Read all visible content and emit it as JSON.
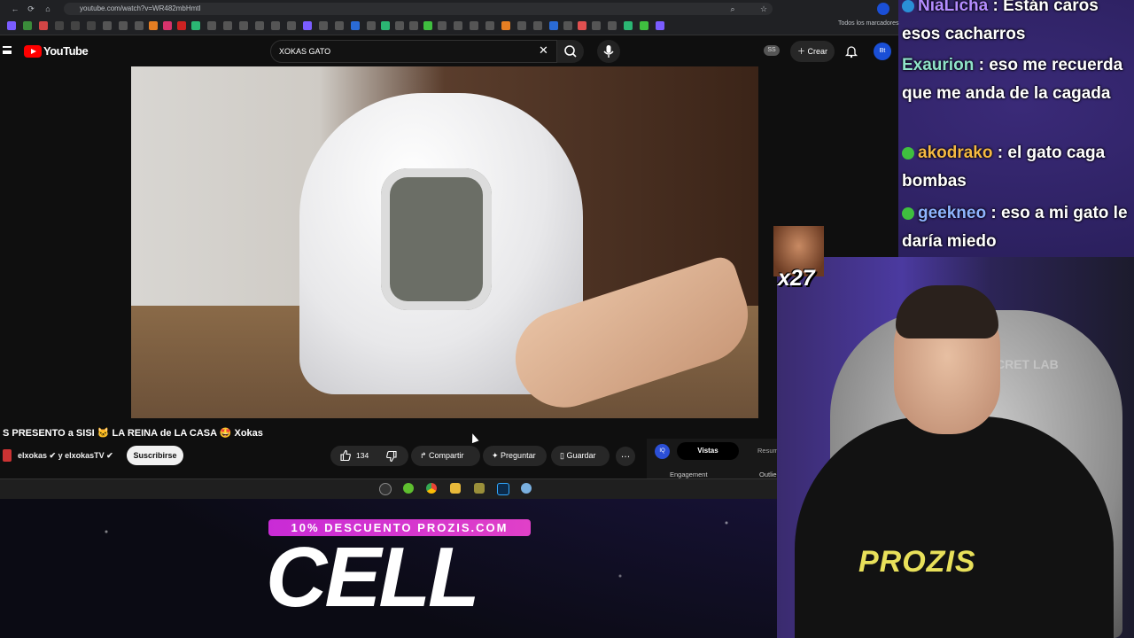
{
  "browser": {
    "url": "youtube.com/watch?v=WR482mbHmtI",
    "bookmarks_all": "Todos los marcadores"
  },
  "youtube": {
    "logo_text": "YouTube",
    "search_value": "XOKAS GATO",
    "ss_badge": "SS",
    "create_label": "Crear",
    "avatar_text": "Bt",
    "video": {
      "title": "S PRESENTO a SISI 🐱 LA REINA de LA CASA 🤩 Xokas",
      "channel": "elxokas ✔ y elxokasTV ✔",
      "subscribe_label": "Suscribirse",
      "likes": "134",
      "share_label": "Compartir",
      "ask_label": "Preguntar",
      "save_label": "Guardar",
      "more_label": "…"
    },
    "extension": {
      "icon_text": "IQ",
      "tab_views": "Vistas",
      "tab_summary": "Resum",
      "engagement_label": "Engagement",
      "outliers_label": "Outlie"
    }
  },
  "chat": [
    {
      "user": "NiaLicha",
      "user_color": "#b48cff",
      "message": ": Están caros esos cacharros"
    },
    {
      "user": "Exaurion",
      "user_color": "#8fe3c9",
      "message": ": eso me recuerda que me anda de la cagada"
    },
    {
      "user": "akodrako",
      "user_color": "#f5b942",
      "message": ": el gato caga bombas"
    },
    {
      "user": "geekneo",
      "user_color": "#8fb5ff",
      "message": ": eso a mi gato le daría miedo"
    }
  ],
  "emote": {
    "count": "x27"
  },
  "webcam": {
    "shirt_text": "PROZIS",
    "sign_text": "CRET LAB"
  },
  "ad": {
    "promo_text": "10% DESCUENTO PROZIS.COM",
    "headline": "CELL"
  },
  "colors": {
    "youtube_red": "#ff0000",
    "promo_magenta": "#d83ad0",
    "chat_text": "#ffffff"
  }
}
